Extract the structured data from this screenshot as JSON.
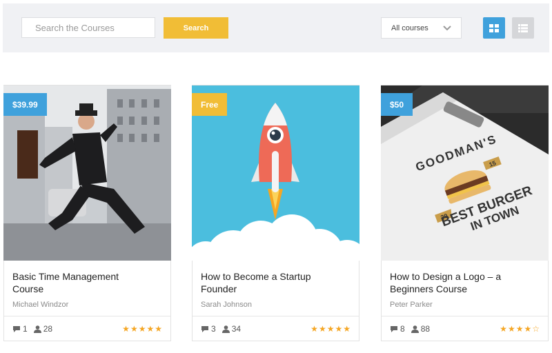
{
  "search": {
    "placeholder": "Search the Courses",
    "button_label": "Search"
  },
  "filter": {
    "selected": "All courses"
  },
  "colors": {
    "accent_blue": "#3fa1dc",
    "accent_yellow": "#f1bd36",
    "star": "#f5a623"
  },
  "courses": [
    {
      "price": "$39.99",
      "title": "Basic Time Management Course",
      "author": "Michael Windzor",
      "comments": "1",
      "students": "28",
      "rating": 5,
      "image": "businessman-jumping"
    },
    {
      "price": "Free",
      "title": "How to Become a Startup Founder",
      "author": "Sarah Johnson",
      "comments": "3",
      "students": "34",
      "rating": 5,
      "image": "rocket-launch"
    },
    {
      "price": "$50",
      "title": "How to Design a Logo – a Beginners Course",
      "author": "Peter Parker",
      "comments": "8",
      "students": "88",
      "rating": 4,
      "image": "burger-logo-clipboard"
    }
  ],
  "logo_text": {
    "top": "GOODMAN'S",
    "line1": "BEST BURGER",
    "line2": "IN TOWN",
    "left_num": "20",
    "right_num": "15"
  }
}
